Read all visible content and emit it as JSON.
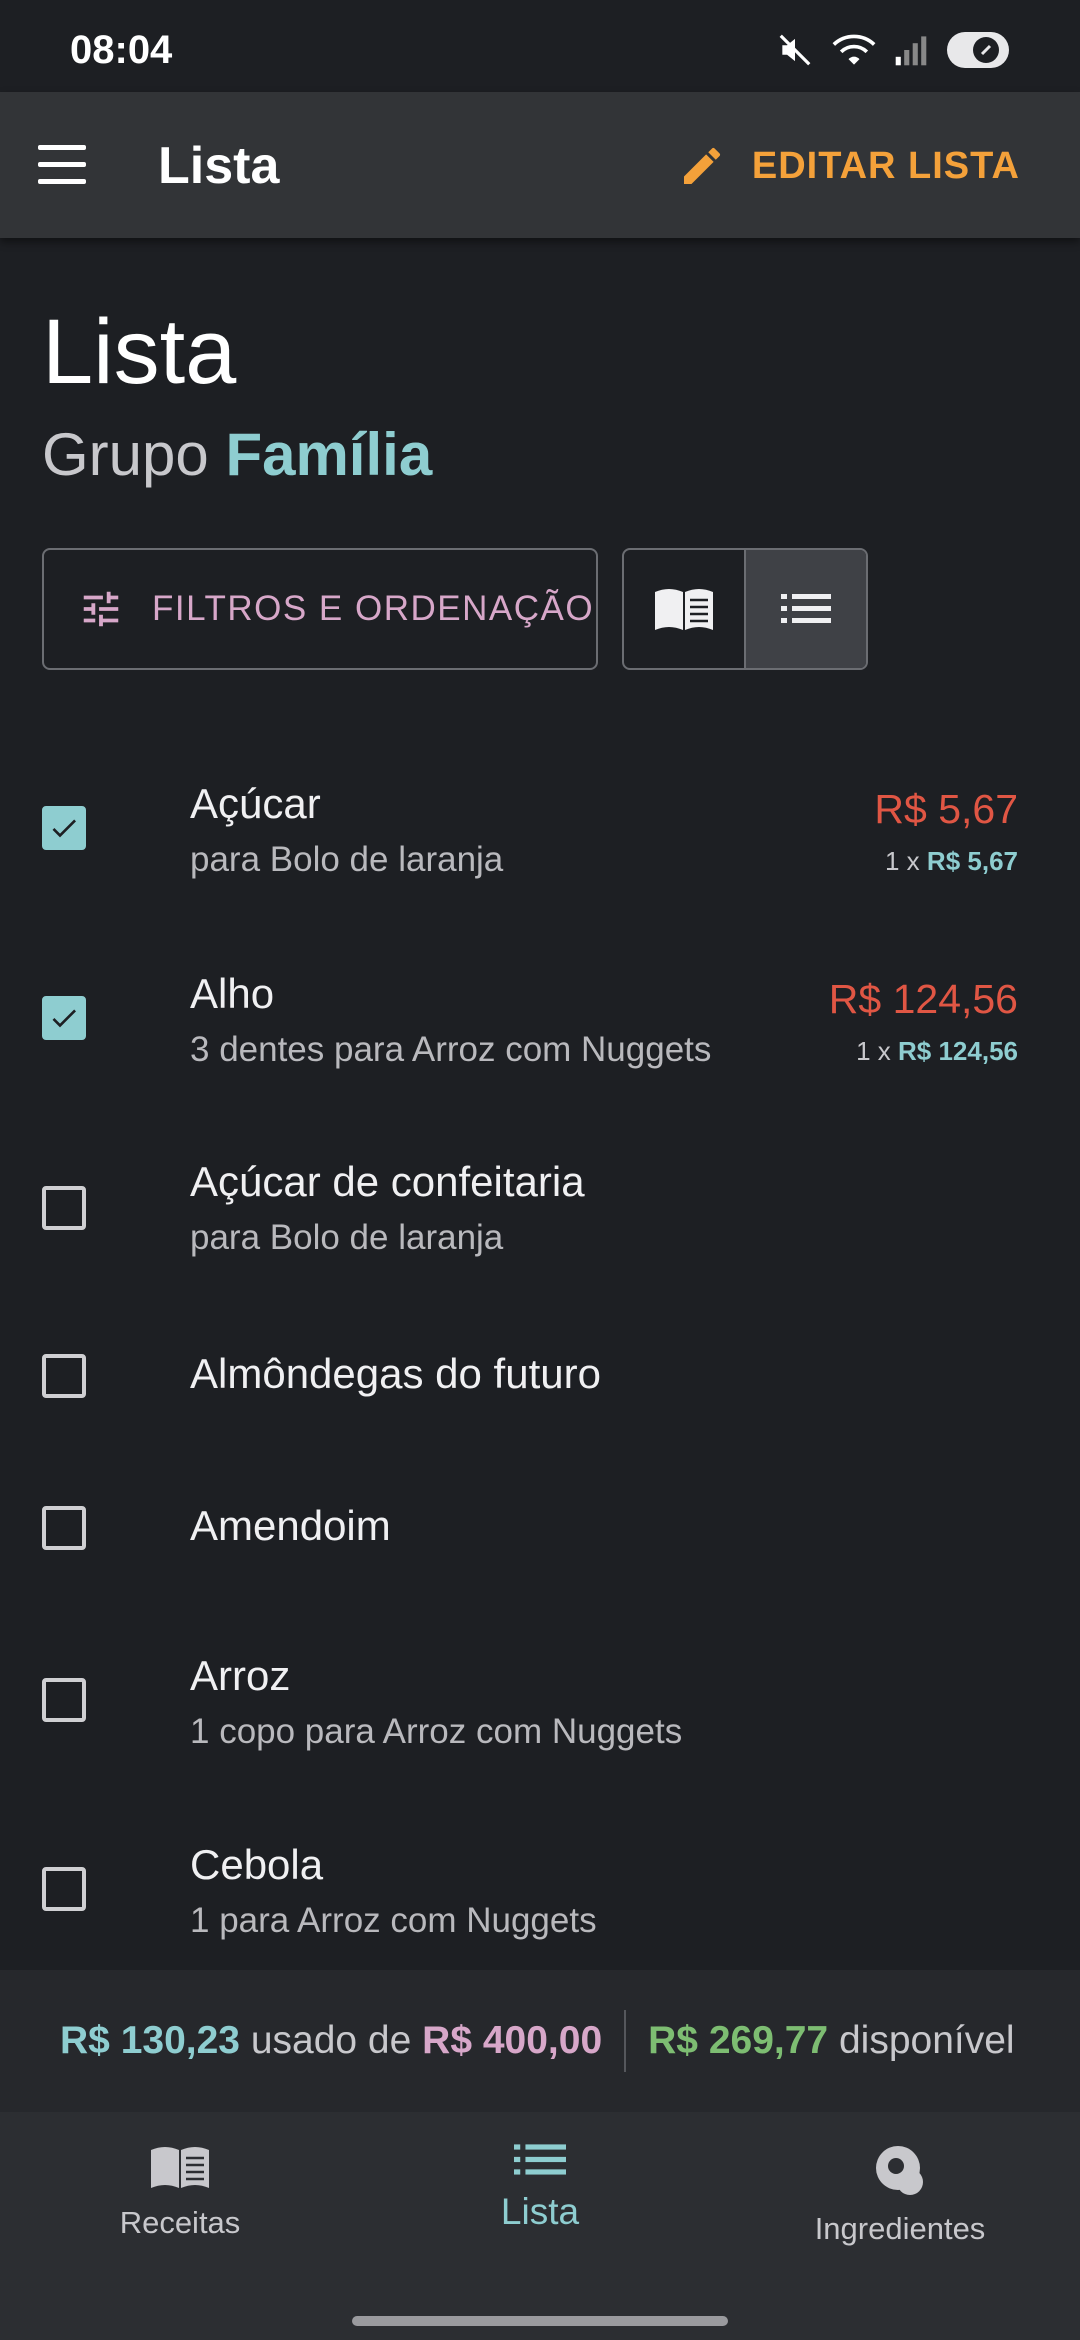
{
  "status_bar": {
    "time": "08:04",
    "icons": [
      "mute-icon",
      "wifi-icon",
      "signal-icon",
      "battery-saver-icon"
    ]
  },
  "app_bar": {
    "title": "Lista",
    "edit_label": "EDITAR LISTA",
    "accent": "#f4a13a"
  },
  "header": {
    "title": "Lista",
    "group_prefix": "Grupo",
    "group_name": "Família"
  },
  "controls": {
    "filters_label": "FILTROS E ORDENAÇÃO",
    "view_modes": [
      "book-view",
      "list-view"
    ],
    "selected_view": "list-view"
  },
  "items": [
    {
      "name": "Açúcar",
      "detail": "para Bolo de laranja",
      "checked": true,
      "price": "R$ 5,67",
      "qty": "1 x",
      "unit_price": "R$ 5,67"
    },
    {
      "name": "Alho",
      "detail": "3 dentes para Arroz com Nuggets",
      "checked": true,
      "price": "R$ 124,56",
      "qty": "1 x",
      "unit_price": "R$ 124,56"
    },
    {
      "name": "Açúcar de confeitaria",
      "detail": "para Bolo de laranja",
      "checked": false
    },
    {
      "name": "Almôndegas do futuro",
      "checked": false
    },
    {
      "name": "Amendoim",
      "checked": false
    },
    {
      "name": "Arroz",
      "detail": "1 copo para Arroz com Nuggets",
      "checked": false
    },
    {
      "name": "Cebola",
      "detail": "1 para Arroz com Nuggets",
      "checked": false
    }
  ],
  "budget": {
    "used": "R$ 130,23",
    "used_of": "usado de",
    "total": "R$ 400,00",
    "available": "R$ 269,77",
    "available_label": "disponível"
  },
  "bottom_nav": [
    {
      "label": "Receitas",
      "icon": "book-icon",
      "active": false
    },
    {
      "label": "Lista",
      "icon": "list-icon",
      "active": true
    },
    {
      "label": "Ingredientes",
      "icon": "ingredients-icon",
      "active": false
    }
  ],
  "colors": {
    "primary": "#8ecdd0",
    "secondary": "#d7a7c9",
    "price": "#e05644",
    "available": "#7dbd72"
  }
}
